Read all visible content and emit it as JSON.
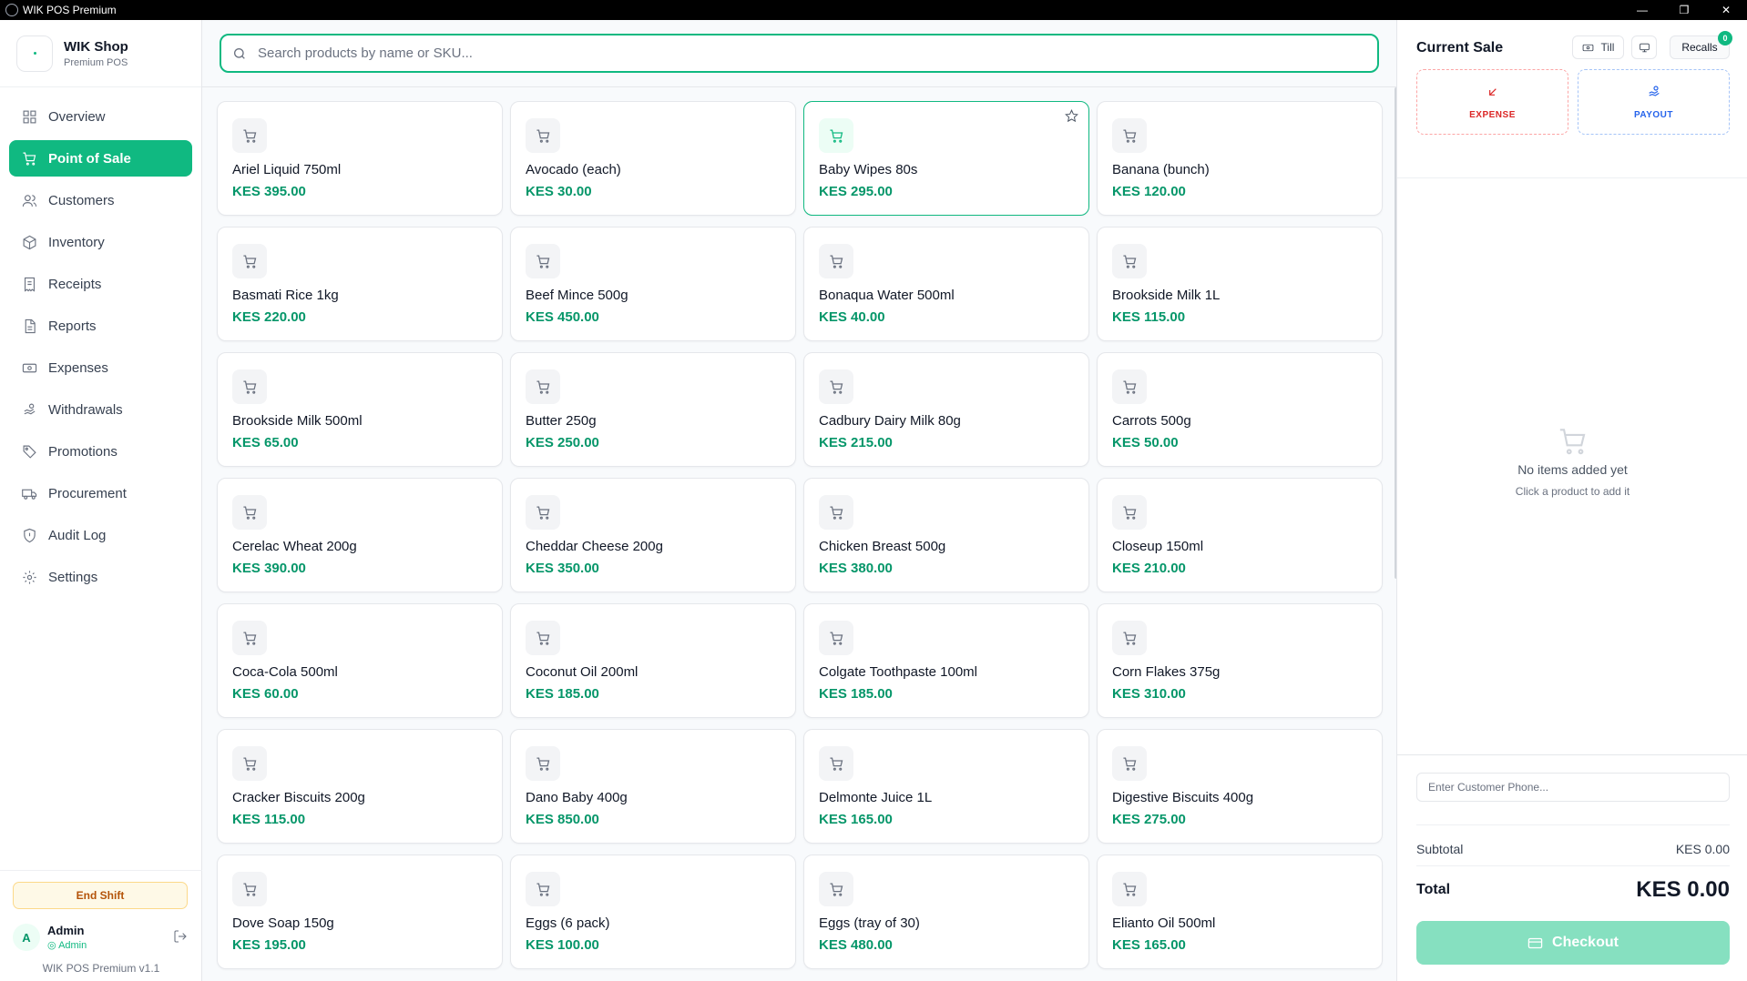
{
  "window": {
    "title": "WIK POS Premium",
    "controls": [
      "—",
      "❐",
      "✕"
    ]
  },
  "brand": {
    "name": "WIK Shop",
    "subtitle": "Premium POS"
  },
  "nav": [
    {
      "label": "Overview",
      "icon": "grid-icon",
      "active": false
    },
    {
      "label": "Point of Sale",
      "icon": "cart-icon",
      "active": true
    },
    {
      "label": "Customers",
      "icon": "users-icon",
      "active": false
    },
    {
      "label": "Inventory",
      "icon": "box-icon",
      "active": false
    },
    {
      "label": "Receipts",
      "icon": "receipt-icon",
      "active": false
    },
    {
      "label": "Reports",
      "icon": "report-icon",
      "active": false
    },
    {
      "label": "Expenses",
      "icon": "wallet-icon",
      "active": false
    },
    {
      "label": "Withdrawals",
      "icon": "hand-coins-icon",
      "active": false
    },
    {
      "label": "Promotions",
      "icon": "tag-icon",
      "active": false
    },
    {
      "label": "Procurement",
      "icon": "truck-icon",
      "active": false
    },
    {
      "label": "Audit Log",
      "icon": "shield-icon",
      "active": false
    },
    {
      "label": "Settings",
      "icon": "gear-icon",
      "active": false
    }
  ],
  "sidebar_bottom": {
    "end_shift": "End Shift",
    "user": {
      "initial": "A",
      "name": "Admin",
      "role": "Admin"
    },
    "version": "WIK POS Premium v1.1"
  },
  "search": {
    "placeholder": "Search products by name or SKU...",
    "value": ""
  },
  "products": [
    {
      "name": "Ariel Liquid 750ml",
      "price": "KES 395.00"
    },
    {
      "name": "Avocado (each)",
      "price": "KES 30.00"
    },
    {
      "name": "Baby Wipes 80s",
      "price": "KES 295.00",
      "highlight": true
    },
    {
      "name": "Banana (bunch)",
      "price": "KES 120.00"
    },
    {
      "name": "Basmati Rice 1kg",
      "price": "KES 220.00"
    },
    {
      "name": "Beef Mince 500g",
      "price": "KES 450.00"
    },
    {
      "name": "Bonaqua Water 500ml",
      "price": "KES 40.00"
    },
    {
      "name": "Brookside Milk 1L",
      "price": "KES 115.00"
    },
    {
      "name": "Brookside Milk 500ml",
      "price": "KES 65.00"
    },
    {
      "name": "Butter 250g",
      "price": "KES 250.00"
    },
    {
      "name": "Cadbury Dairy Milk 80g",
      "price": "KES 215.00"
    },
    {
      "name": "Carrots 500g",
      "price": "KES 50.00"
    },
    {
      "name": "Cerelac Wheat 200g",
      "price": "KES 390.00"
    },
    {
      "name": "Cheddar Cheese 200g",
      "price": "KES 350.00"
    },
    {
      "name": "Chicken Breast 500g",
      "price": "KES 380.00"
    },
    {
      "name": "Closeup 150ml",
      "price": "KES 210.00"
    },
    {
      "name": "Coca-Cola 500ml",
      "price": "KES 60.00"
    },
    {
      "name": "Coconut Oil 200ml",
      "price": "KES 185.00"
    },
    {
      "name": "Colgate Toothpaste 100ml",
      "price": "KES 185.00"
    },
    {
      "name": "Corn Flakes 375g",
      "price": "KES 310.00"
    },
    {
      "name": "Cracker Biscuits 200g",
      "price": "KES 115.00"
    },
    {
      "name": "Dano Baby 400g",
      "price": "KES 850.00"
    },
    {
      "name": "Delmonte Juice 1L",
      "price": "KES 165.00"
    },
    {
      "name": "Digestive Biscuits 400g",
      "price": "KES 275.00"
    },
    {
      "name": "Dove Soap 150g",
      "price": "KES 195.00"
    },
    {
      "name": "Eggs (6 pack)",
      "price": "KES 100.00"
    },
    {
      "name": "Eggs (tray of 30)",
      "price": "KES 480.00"
    },
    {
      "name": "Elianto Oil 500ml",
      "price": "KES 165.00"
    }
  ],
  "cart": {
    "title": "Current Sale",
    "till_label": "Till",
    "recalls_label": "Recalls",
    "recalls_count": "0",
    "expense_label": "EXPENSE",
    "payout_label": "PAYOUT",
    "empty_title": "No items added yet",
    "empty_sub": "Click a product to add it",
    "phone_placeholder": "Enter Customer Phone...",
    "subtotal_label": "Subtotal",
    "subtotal_value": "KES 0.00",
    "total_label": "Total",
    "total_value": "KES 0.00",
    "checkout_label": "Checkout"
  },
  "colors": {
    "accent": "#10b981",
    "price": "#059669",
    "expense": "#dc2626",
    "payout": "#2563eb",
    "checkout_disabled": "#86e0c0"
  }
}
